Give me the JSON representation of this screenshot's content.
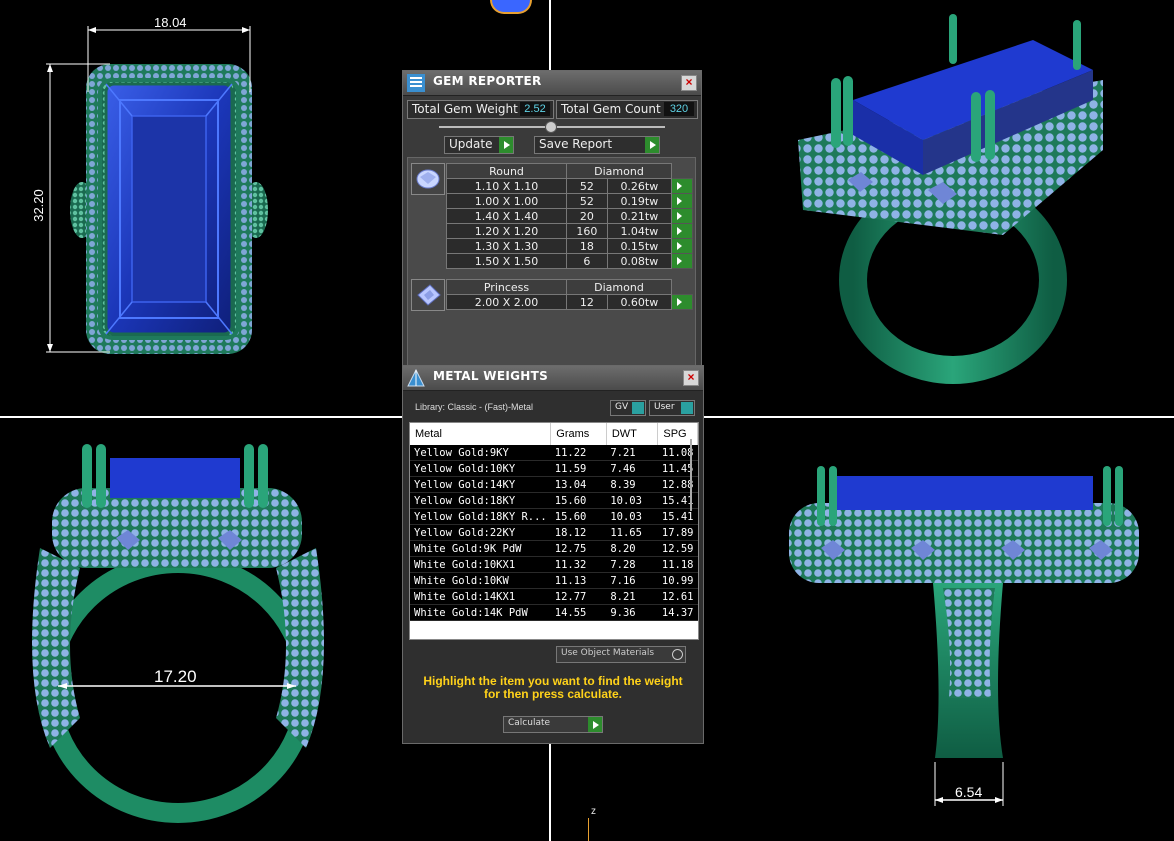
{
  "viewports": {
    "top_left_dim_width": "18.04",
    "top_left_dim_height": "32.20",
    "bottom_left_dim_inner": "17.20",
    "bottom_right_dim_shank": "6.54",
    "axis_label_z": "z"
  },
  "gem_reporter": {
    "title": "GEM REPORTER",
    "close": "×",
    "total_gem_weight_label": "Total Gem Weight",
    "total_gem_weight_value": "2.52",
    "total_gem_count_label": "Total Gem Count",
    "total_gem_count_value": "320",
    "update_label": "Update",
    "save_report_label": "Save Report",
    "groups": [
      {
        "shape": "Round",
        "type": "Diamond",
        "rows": [
          {
            "size": "1.10 X 1.10",
            "count": "52",
            "weight": "0.26tw"
          },
          {
            "size": "1.00 X 1.00",
            "count": "52",
            "weight": "0.19tw"
          },
          {
            "size": "1.40 X 1.40",
            "count": "20",
            "weight": "0.21tw"
          },
          {
            "size": "1.20 X 1.20",
            "count": "160",
            "weight": "1.04tw"
          },
          {
            "size": "1.30 X 1.30",
            "count": "18",
            "weight": "0.15tw"
          },
          {
            "size": "1.50 X 1.50",
            "count": "6",
            "weight": "0.08tw"
          }
        ]
      },
      {
        "shape": "Princess",
        "type": "Diamond",
        "rows": [
          {
            "size": "2.00 X 2.00",
            "count": "12",
            "weight": "0.60tw"
          }
        ]
      }
    ]
  },
  "metal_weights": {
    "title": "METAL WEIGHTS",
    "close": "×",
    "library": "Library: Classic - (Fast)-Metal",
    "gv_label": "GV",
    "user_label": "User",
    "columns": [
      "Metal",
      "Grams",
      "DWT",
      "SPG"
    ],
    "rows": [
      [
        "Yellow Gold:9KY",
        "11.22",
        "7.21",
        "11.08"
      ],
      [
        "Yellow Gold:10KY",
        "11.59",
        "7.46",
        "11.45"
      ],
      [
        "Yellow Gold:14KY",
        "13.04",
        "8.39",
        "12.88"
      ],
      [
        "Yellow Gold:18KY",
        "15.60",
        "10.03",
        "15.41"
      ],
      [
        "Yellow Gold:18KY R...",
        "15.60",
        "10.03",
        "15.41"
      ],
      [
        "Yellow Gold:22KY",
        "18.12",
        "11.65",
        "17.89"
      ],
      [
        "White Gold:9K PdW",
        "12.75",
        "8.20",
        "12.59"
      ],
      [
        "White Gold:10KX1",
        "11.32",
        "7.28",
        "11.18"
      ],
      [
        "White Gold:10KW",
        "11.13",
        "7.16",
        "10.99"
      ],
      [
        "White Gold:14KX1",
        "12.77",
        "8.21",
        "12.61"
      ],
      [
        "White Gold:14K PdW",
        "14.55",
        "9.36",
        "14.37"
      ]
    ],
    "use_object_materials": "Use Object Materials",
    "note_line1": "Highlight the item you want to find the weight",
    "note_line2": "for then press calculate.",
    "calculate_label": "Calculate"
  }
}
